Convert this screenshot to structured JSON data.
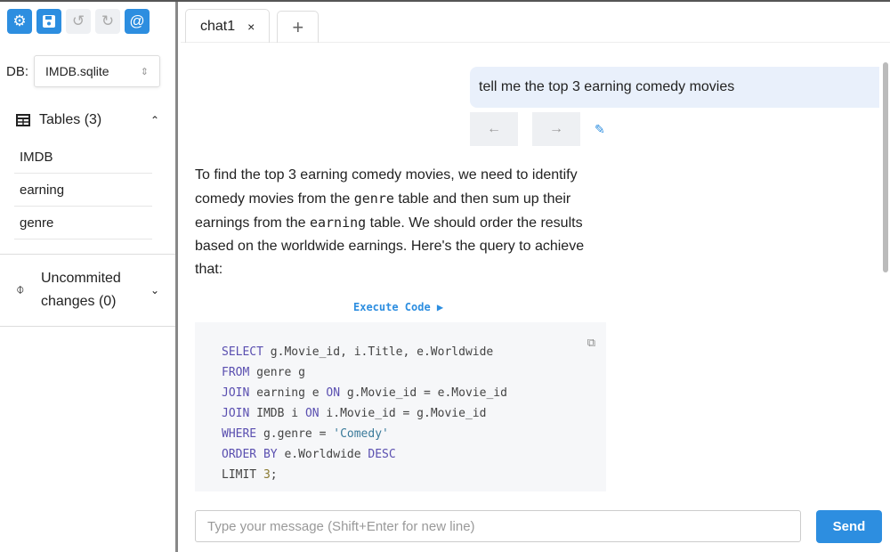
{
  "toolbar": {
    "settings": "⚙",
    "save": "💾",
    "undo": "↺",
    "redo": "↻",
    "at": "@"
  },
  "db": {
    "label": "DB:",
    "value": "IMDB.sqlite"
  },
  "tables": {
    "label": "Tables (3)",
    "items": [
      "IMDB",
      "earning",
      "genre"
    ]
  },
  "uncommitted": {
    "line1": "Uncommited",
    "line2": "changes (0)"
  },
  "tabs": [
    {
      "label": "chat1",
      "close": "×"
    }
  ],
  "add_tab": "+",
  "user_message": "tell me the top 3 earning comedy movies",
  "response": {
    "p1": "To find the top 3 earning comedy movies, we need to identify comedy movies from the ",
    "c1": "genre",
    "p2": " table and then sum up their earnings from the ",
    "c2": "earning",
    "p3": " table. We should order the results based on the worldwide earnings. Here's the query to achieve that:"
  },
  "execute_label": "Execute Code ▶",
  "code": [
    [
      [
        "kw",
        "SELECT"
      ],
      [
        "",
        "g.Movie_id, i.Title, e.Worldwide"
      ]
    ],
    [
      [
        "kw",
        "FROM"
      ],
      [
        "",
        "genre g"
      ]
    ],
    [
      [
        "kw",
        "JOIN"
      ],
      [
        "",
        "earning e "
      ],
      [
        "kw",
        "ON"
      ],
      [
        "",
        "g.Movie_id = e.Movie_id"
      ]
    ],
    [
      [
        "kw",
        "JOIN"
      ],
      [
        "",
        "IMDB i "
      ],
      [
        "kw",
        "ON"
      ],
      [
        "",
        "i.Movie_id = g.Movie_id"
      ]
    ],
    [
      [
        "kw",
        "WHERE"
      ],
      [
        "",
        "g.genre = "
      ],
      [
        "str",
        "'Comedy'"
      ]
    ],
    [
      [
        "kw",
        "ORDER BY"
      ],
      [
        "",
        "e.Worldwide "
      ],
      [
        "kw",
        "DESC"
      ]
    ],
    [
      [
        "",
        "LIMIT "
      ],
      [
        "num",
        "3"
      ],
      [
        "",
        ";"
      ]
    ]
  ],
  "input": {
    "placeholder": "Type your message (Shift+Enter for new line)"
  },
  "send_label": "Send"
}
